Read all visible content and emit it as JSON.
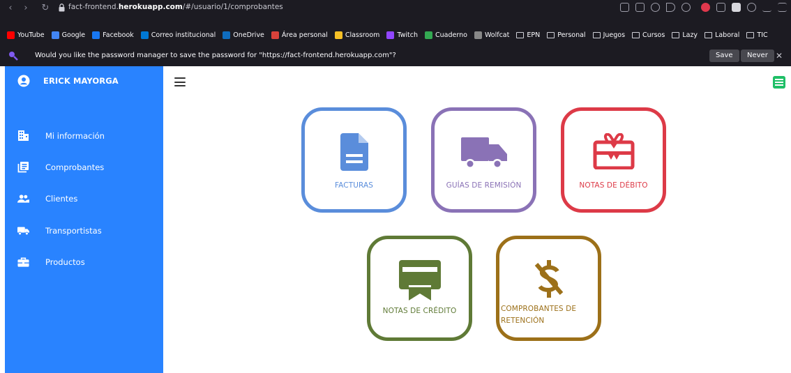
{
  "browser": {
    "url_prefix": "fact-frontend.",
    "url_host": "herokuapp.com",
    "url_path": "/#/usuario/1/comprobantes",
    "bookmarks": [
      {
        "label": "YouTube",
        "color": "#ff0000",
        "kind": "fav"
      },
      {
        "label": "Google",
        "color": "#4285f4",
        "kind": "fav"
      },
      {
        "label": "Facebook",
        "color": "#1877f2",
        "kind": "fav"
      },
      {
        "label": "Correo institucional",
        "color": "#0078d4",
        "kind": "fav"
      },
      {
        "label": "OneDrive",
        "color": "#0f6cbd",
        "kind": "fav"
      },
      {
        "label": "Área personal",
        "color": "#d9423b",
        "kind": "fav"
      },
      {
        "label": "Classroom",
        "color": "#f6c026",
        "kind": "fav"
      },
      {
        "label": "Twitch",
        "color": "#9146ff",
        "kind": "fav"
      },
      {
        "label": "Cuaderno",
        "color": "#33a852",
        "kind": "fav"
      },
      {
        "label": "Wolfcat",
        "color": "#888888",
        "kind": "fav"
      },
      {
        "label": "EPN",
        "kind": "folder"
      },
      {
        "label": "Personal",
        "kind": "folder"
      },
      {
        "label": "Juegos",
        "kind": "folder"
      },
      {
        "label": "Cursos",
        "kind": "folder"
      },
      {
        "label": "Lazy",
        "kind": "folder"
      },
      {
        "label": "Laboral",
        "kind": "folder"
      },
      {
        "label": "TIC",
        "kind": "folder"
      }
    ],
    "password_prompt": "Would you like the password manager to save the password for \"https://fact-frontend.herokuapp.com\"?",
    "save_label": "Save",
    "never_label": "Never"
  },
  "sidebar": {
    "user_name": "ERICK MAYORGA",
    "items": [
      {
        "label": "Mi información",
        "icon": "building-icon"
      },
      {
        "label": "Comprobantes",
        "icon": "document-list-icon"
      },
      {
        "label": "Clientes",
        "icon": "users-icon"
      },
      {
        "label": "Transportistas",
        "icon": "truck-icon"
      },
      {
        "label": "Productos",
        "icon": "briefcase-icon"
      }
    ]
  },
  "cards": [
    {
      "label": "FACTURAS",
      "color": "#5a8ddb",
      "icon": "invoice-document-icon"
    },
    {
      "label": "GUÍAS DE REMISIÓN",
      "color": "#8a72b6",
      "icon": "truck-icon"
    },
    {
      "label": "NOTAS DE DÉBITO",
      "color": "#dd3a47",
      "icon": "gift-card-icon"
    },
    {
      "label": "NOTAS DE CRÉDITO",
      "color": "#5f7a36",
      "icon": "credit-certificate-icon"
    },
    {
      "label_line1": "COMPROBANTES DE",
      "label_line2": "RETENCIÓN",
      "color": "#9c7019",
      "icon": "dollar-off-icon"
    }
  ],
  "colors": {
    "sidebar": "#2983ff",
    "chrome": "#1c1b22"
  }
}
